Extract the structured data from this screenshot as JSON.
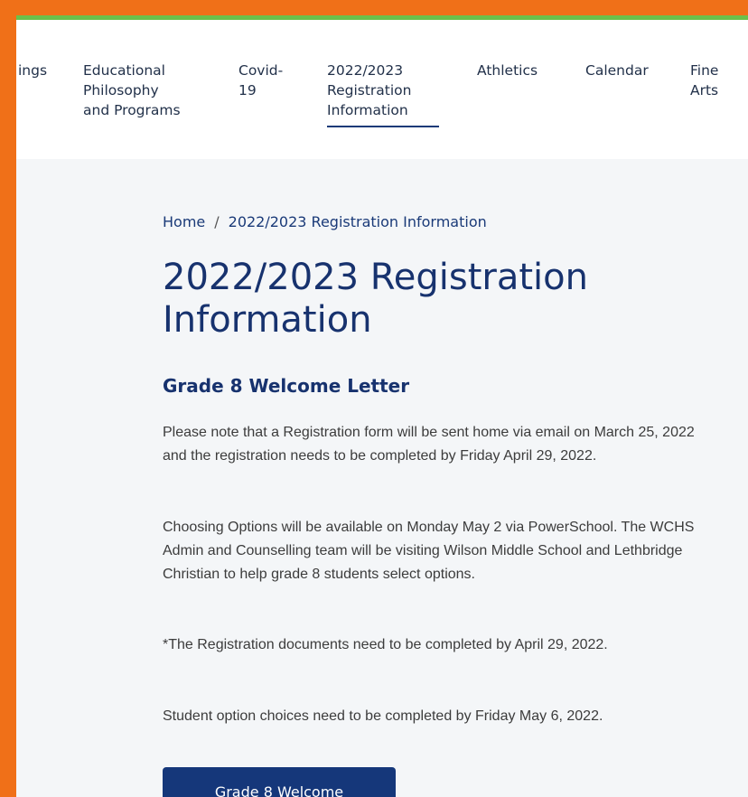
{
  "nav": {
    "items": [
      {
        "lines": [
          "ings"
        ]
      },
      {
        "lines": [
          "Educational",
          "Philosophy",
          "and Programs"
        ]
      },
      {
        "lines": [
          "Covid-",
          "19"
        ]
      },
      {
        "lines": [
          "2022/2023",
          "Registration",
          "Information"
        ],
        "active": true
      },
      {
        "lines": [
          "Athletics"
        ]
      },
      {
        "lines": [
          "Calendar"
        ]
      },
      {
        "lines": [
          "Fine",
          "Arts"
        ]
      }
    ]
  },
  "breadcrumb": {
    "home": "Home",
    "separator": "/",
    "current": "2022/2023 Registration Information"
  },
  "page": {
    "title": "2022/2023 Registration Information",
    "subtitle": "Grade 8 Welcome Letter",
    "paragraphs": [
      "Please note that a Registration form will be sent home via email on March 25, 2022 and the registration needs to be completed by Friday April 29, 2022.",
      "Choosing Options will be available on Monday May 2 via PowerSchool. The WCHS Admin and Counselling team will be visiting Wilson Middle School and Lethbridge Christian to help grade 8 students select options.",
      "*The Registration documents need to be completed by April 29, 2022.",
      "Student option choices need to be completed by Friday May 6, 2022."
    ],
    "button_label": "Grade 8 Welcome"
  },
  "colors": {
    "frame": "#f07018",
    "accent_line": "#6cc04a",
    "primary": "#17326e"
  }
}
